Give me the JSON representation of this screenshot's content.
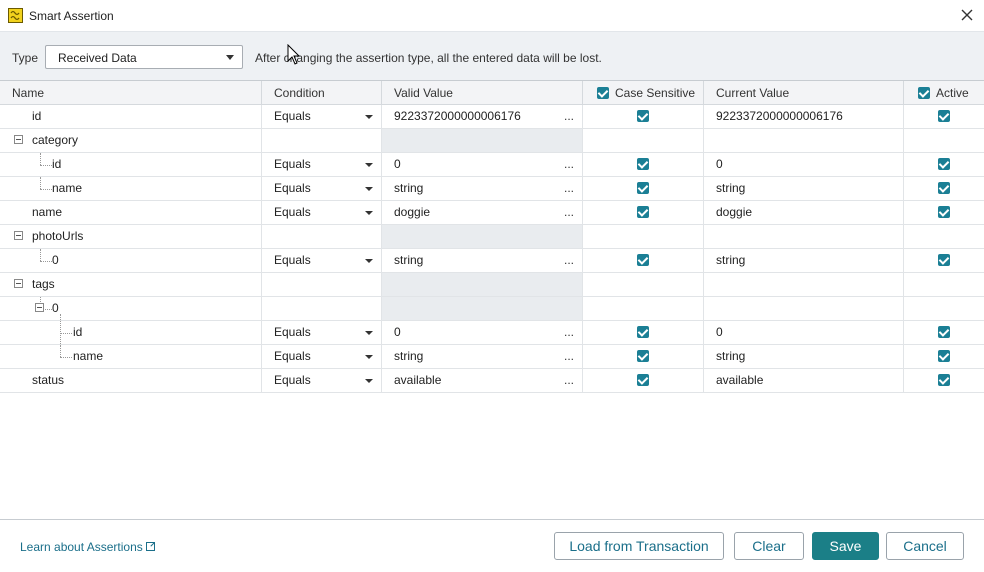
{
  "window": {
    "title": "Smart Assertion",
    "close_icon": "close-icon",
    "app_icon": "smart-assertion-app-icon"
  },
  "typebar": {
    "label": "Type",
    "selected": "Received Data",
    "warning": "After changing the assertion type, all the entered data will be lost."
  },
  "columns": {
    "name": "Name",
    "condition": "Condition",
    "valid_value": "Valid Value",
    "case_sensitive": "Case Sensitive",
    "current_value": "Current Value",
    "active": "Active"
  },
  "header_checks": {
    "case_sensitive": true,
    "active": true
  },
  "rows": [
    {
      "name": "id",
      "condition": "Equals",
      "valid": "9223372000000006176",
      "case": true,
      "current": "9223372000000006176",
      "active": true
    },
    {
      "name": "category",
      "group": true
    },
    {
      "name": "id",
      "condition": "Equals",
      "valid": "0",
      "case": true,
      "current": "0",
      "active": true
    },
    {
      "name": "name",
      "condition": "Equals",
      "valid": "string",
      "case": true,
      "current": "string",
      "active": true
    },
    {
      "name": "name",
      "condition": "Equals",
      "valid": "doggie",
      "case": true,
      "current": "doggie",
      "active": true
    },
    {
      "name": "photoUrls",
      "group": true
    },
    {
      "name": "0",
      "condition": "Equals",
      "valid": "string",
      "case": true,
      "current": "string",
      "active": true
    },
    {
      "name": "tags",
      "group": true
    },
    {
      "name": "0",
      "group": true
    },
    {
      "name": "id",
      "condition": "Equals",
      "valid": "0",
      "case": true,
      "current": "0",
      "active": true
    },
    {
      "name": "name",
      "condition": "Equals",
      "valid": "string",
      "case": true,
      "current": "string",
      "active": true
    },
    {
      "name": "status",
      "condition": "Equals",
      "valid": "available",
      "case": true,
      "current": "available",
      "active": true
    }
  ],
  "valid_ellipsis": "...",
  "footer": {
    "learn_link": "Learn about Assertions",
    "load_button": "Load from Transaction",
    "clear_button": "Clear",
    "save_button": "Save",
    "cancel_button": "Cancel"
  },
  "colors": {
    "accent": "#1b7f87",
    "link": "#1b6f8a",
    "checkbox": "#1b7f95"
  }
}
